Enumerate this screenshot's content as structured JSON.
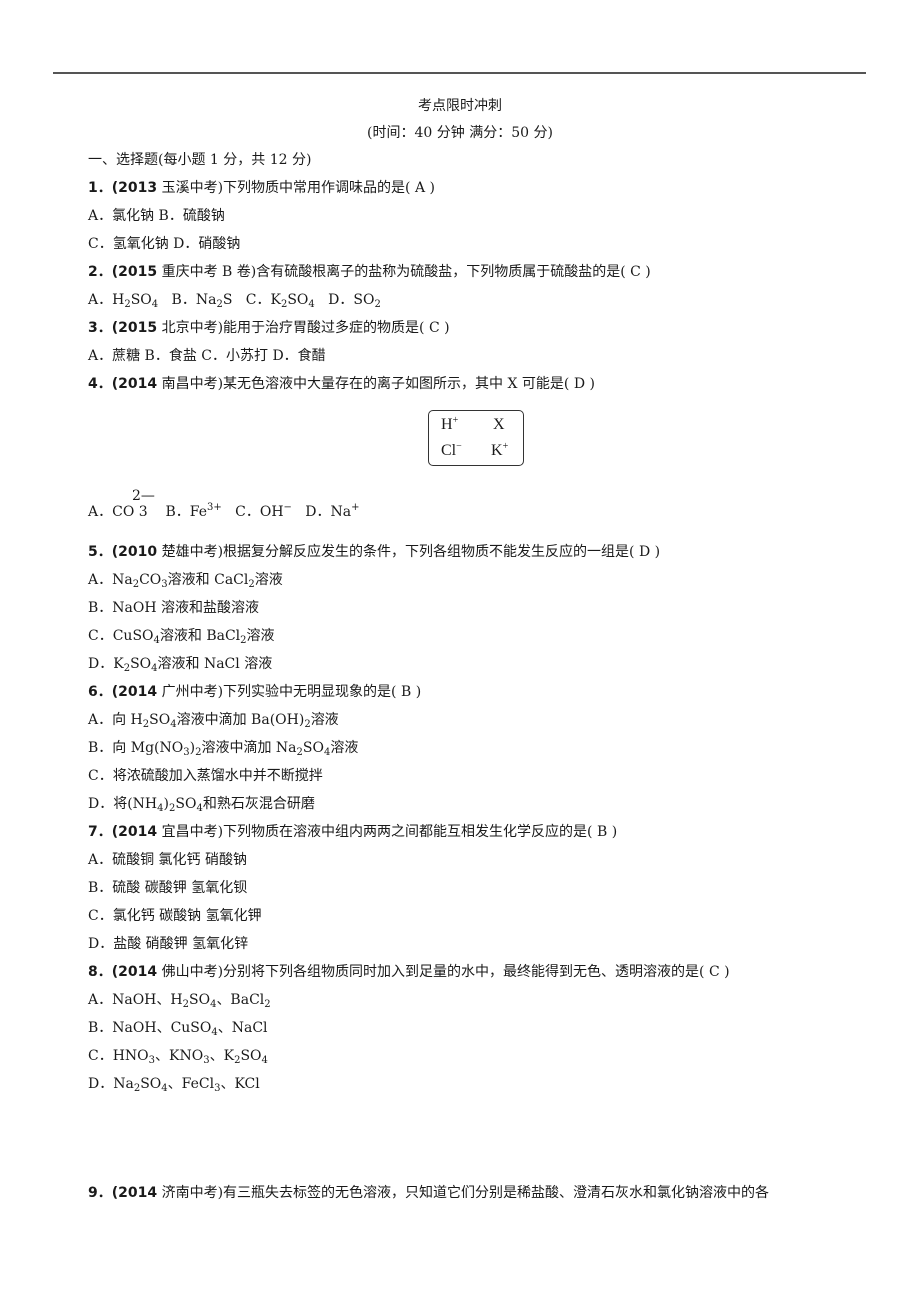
{
  "header": {
    "title": "考点限时冲刺",
    "subtitle": "(时间：40 分钟  满分：50 分)"
  },
  "section": {
    "heading": "一、选择题(每小题 1 分，共 12 分)"
  },
  "questions": [
    {
      "num": "1．",
      "source": "(2013",
      "stem": "玉溪中考)下列物质中常用作调味品的是( A )",
      "options": [
        "A．氯化钠   B．硫酸钠",
        "C．氢氧化钠   D．硝酸钠"
      ]
    },
    {
      "num": "2．",
      "source": "(2015",
      "stem": "重庆中考 B 卷)含有硫酸根离子的盐称为硫酸盐，下列物质属于硫酸盐的是( C )",
      "options": {
        "a_label": "A．",
        "a_f1": "H",
        "a_s1": "2",
        "a_f2": "SO",
        "a_s2": "4",
        "b_label": "B．",
        "b_f1": "Na",
        "b_s1": "2",
        "b_f2": "S",
        "c_label": "C．",
        "c_f1": "K",
        "c_s1": "2",
        "c_f2": "SO",
        "c_s2": "4",
        "d_label": "D．",
        "d_f1": "SO",
        "d_s1": "2"
      }
    },
    {
      "num": "3．",
      "source": "(2015",
      "stem": "北京中考)能用于治疗胃酸过多症的物质是( C )",
      "options": [
        "A．蔗糖   B．食盐   C．小苏打   D．食醋"
      ]
    },
    {
      "num": "4．",
      "source": "(2014",
      "stem": "南昌中考)某无色溶液中大量存在的离子如图所示，其中 X 可能是( D )",
      "figure": {
        "ions": [
          {
            "base": "H",
            "charge": "+"
          },
          {
            "base": "X",
            "charge": ""
          },
          {
            "base": "Cl",
            "charge": "−"
          },
          {
            "base": "K",
            "charge": "+"
          }
        ]
      },
      "options": {
        "a_label": "A．CO",
        "a_sub": "3",
        "a_charge": "2—",
        "b_label": "B．Fe",
        "b_charge": "3+",
        "c_label": "C．OH",
        "c_charge": "−",
        "d_label": "D．Na",
        "d_charge": "+"
      }
    },
    {
      "num": "5．",
      "source": "(2010",
      "stem": "楚雄中考)根据复分解反应发生的条件，下列各组物质不能发生反应的一组是( D )",
      "options": {
        "a": {
          "label": "A．Na",
          "s1": "2",
          "t1": "CO",
          "s2": "3",
          "t2": "溶液和 CaCl",
          "s3": "2",
          "t3": "溶液"
        },
        "b": {
          "label": "B．NaOH 溶液和盐酸溶液"
        },
        "c": {
          "label": "C．CuSO",
          "s1": "4",
          "t1": "溶液和 BaCl",
          "s2": "2",
          "t2": "溶液"
        },
        "d": {
          "label": "D．K",
          "s1": "2",
          "t1": "SO",
          "s2": "4",
          "t2": "溶液和 NaCl 溶液"
        }
      }
    },
    {
      "num": "6．",
      "source": "(2014",
      "stem": "广州中考)下列实验中无明显现象的是( B )",
      "options": {
        "a": {
          "label": "A．向 H",
          "s1": "2",
          "t1": "SO",
          "s2": "4",
          "t2": "溶液中滴加 Ba(OH)",
          "s3": "2",
          "t3": "溶液"
        },
        "b": {
          "label": "B．向 Mg(NO",
          "s1": "3",
          "t1": ")",
          "s2": "2",
          "t2": "溶液中滴加 Na",
          "s3": "2",
          "t3": "SO",
          "s4": "4",
          "t4": "溶液"
        },
        "c": {
          "label": "C．将浓硫酸加入蒸馏水中并不断搅拌"
        },
        "d": {
          "label": "D．将(NH",
          "s1": "4",
          "t1": ")",
          "s2": "2",
          "t2": "SO",
          "s3": "4",
          "t3": "和熟石灰混合研磨"
        }
      }
    },
    {
      "num": "7．",
      "source": "(2014",
      "stem": "宜昌中考)下列物质在溶液中组内两两之间都能互相发生化学反应的是( B )",
      "options": [
        "A．硫酸铜  氯化钙  硝酸钠",
        "B．硫酸  碳酸钾  氢氧化钡",
        "C．氯化钙  碳酸钠  氢氧化钾",
        "D．盐酸  硝酸钾  氢氧化锌"
      ]
    },
    {
      "num": "8．",
      "source": "(2014",
      "stem": "佛山中考)分别将下列各组物质同时加入到足量的水中，最终能得到无色、透明溶液的是( C )",
      "options": {
        "a": {
          "label": "A．NaOH、H",
          "s1": "2",
          "t1": "SO",
          "s2": "4",
          "t2": "、BaCl",
          "s3": "2"
        },
        "b": {
          "label": "B．NaOH、CuSO",
          "s1": "4",
          "t1": "、NaCl"
        },
        "c": {
          "label": "C．HNO",
          "s1": "3",
          "t1": "、KNO",
          "s2": "3",
          "t2": "、K",
          "s3": "2",
          "t3": "SO",
          "s4": "4"
        },
        "d": {
          "label": "D．Na",
          "s1": "2",
          "t1": "SO",
          "s2": "4",
          "t2": "、FeCl",
          "s3": "3",
          "t3": "、KCl"
        }
      }
    },
    {
      "num": "9．",
      "source": "(2014",
      "stem": "济南中考)有三瓶失去标签的无色溶液，只知道它们分别是稀盐酸、澄清石灰水和氯化钠溶液中的各"
    }
  ]
}
